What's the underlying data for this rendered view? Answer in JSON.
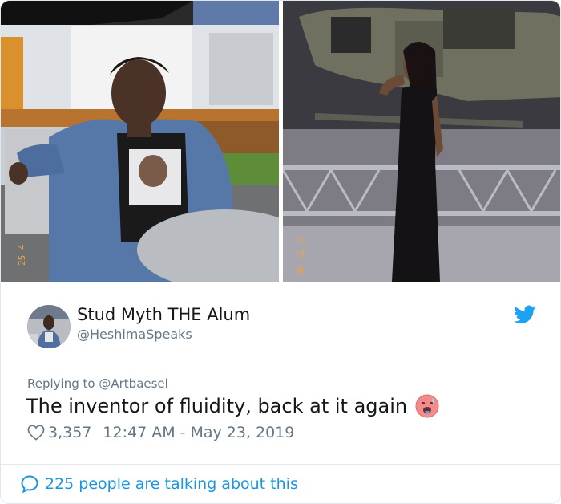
{
  "tweet": {
    "display_name": "Stud Myth THE Alum",
    "handle": "@HeshimaSpeaks",
    "replying_prefix": "Replying to",
    "replying_to": "@Artbaesel",
    "text": "The inventor of fluidity, back at it again",
    "emoji": "hot-face-emoji",
    "likes": "3,357",
    "time": "12:47 AM",
    "date_separator": "-",
    "date": "May 23, 2019",
    "talking": "225 people are talking about this"
  },
  "photos": {
    "left_stamp": "25 4",
    "right_stamp": "98 E2 2"
  },
  "icons": {
    "brand": "twitter-bird-icon",
    "like": "heart-icon",
    "conversation": "speech-bubble-icon"
  },
  "colors": {
    "brand_blue": "#1da1f2",
    "link_blue": "#1b95e0",
    "secondary_text": "#657786",
    "primary_text": "#14171a"
  }
}
